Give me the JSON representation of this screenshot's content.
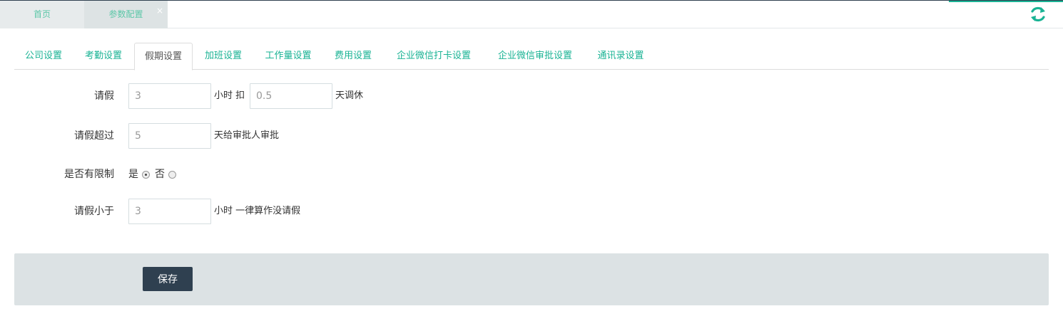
{
  "top_tabs": [
    {
      "label": "首页"
    },
    {
      "label": "参数配置",
      "close": "×"
    }
  ],
  "sub_tabs": [
    {
      "label": "公司设置"
    },
    {
      "label": "考勤设置"
    },
    {
      "label": "假期设置",
      "active": true
    },
    {
      "label": "加班设置"
    },
    {
      "label": "工作量设置"
    },
    {
      "label": "费用设置"
    },
    {
      "label": "企业微信打卡设置"
    },
    {
      "label": "企业微信审批设置"
    },
    {
      "label": "通讯录设置"
    }
  ],
  "form": {
    "leave": {
      "label": "请假",
      "hours_value": "3",
      "mid_text": "小时 扣",
      "days_value": "0.5",
      "suffix": "天调休"
    },
    "leave_exceed": {
      "label": "请假超过",
      "value": "5",
      "suffix": "天给审批人审批"
    },
    "limit": {
      "label": "是否有限制",
      "yes_label": "是",
      "no_label": "否",
      "selected": "yes"
    },
    "leave_less": {
      "label": "请假小于",
      "value": "3",
      "suffix": "小时 一律算作没请假"
    }
  },
  "save_label": "保存",
  "colors": {
    "accent": "#1ab394",
    "dark": "#2f4050",
    "panel": "#dce2e4"
  }
}
